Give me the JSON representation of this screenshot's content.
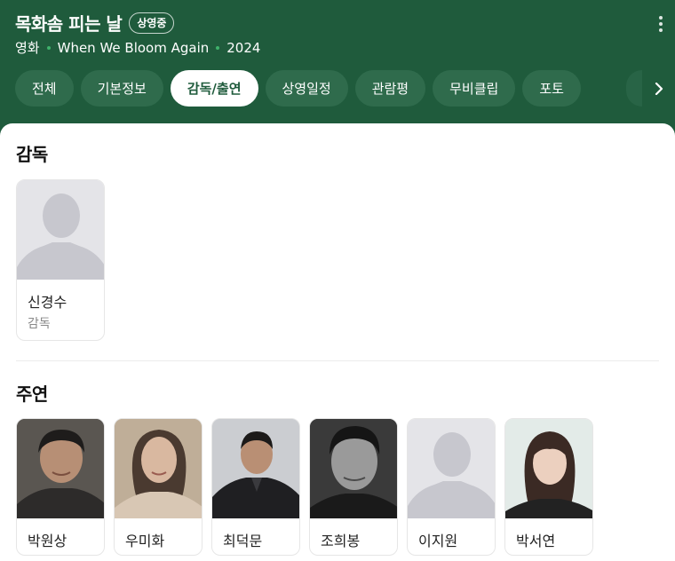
{
  "header": {
    "title": "목화솜 피는 날",
    "badge": "상영중",
    "meta": [
      "영화",
      "When We Bloom Again",
      "2024"
    ]
  },
  "tabs": [
    "전체",
    "기본정보",
    "감독/출연",
    "상영일정",
    "관람평",
    "무비클립",
    "포토"
  ],
  "active_tab": "감독/출연",
  "director_section": {
    "title": "감독",
    "people": [
      {
        "name": "신경수",
        "role": "감독",
        "photo": "placeholder-silhouette"
      }
    ]
  },
  "cast_section": {
    "title": "주연",
    "people": [
      {
        "name": "박원상",
        "photo": "portrait"
      },
      {
        "name": "우미화",
        "photo": "portrait"
      },
      {
        "name": "최덕문",
        "photo": "portrait"
      },
      {
        "name": "조희봉",
        "photo": "portrait"
      },
      {
        "name": "이지원",
        "photo": "placeholder-silhouette"
      },
      {
        "name": "박서연",
        "photo": "portrait"
      }
    ]
  },
  "colors": {
    "brand_green": "#1f5b3c",
    "tab_bg": "#2f6b4c",
    "meta_dot": "#3fb26b"
  },
  "icons": [
    "more-vertical-icon",
    "chevron-right-icon",
    "person-silhouette-icon"
  ]
}
